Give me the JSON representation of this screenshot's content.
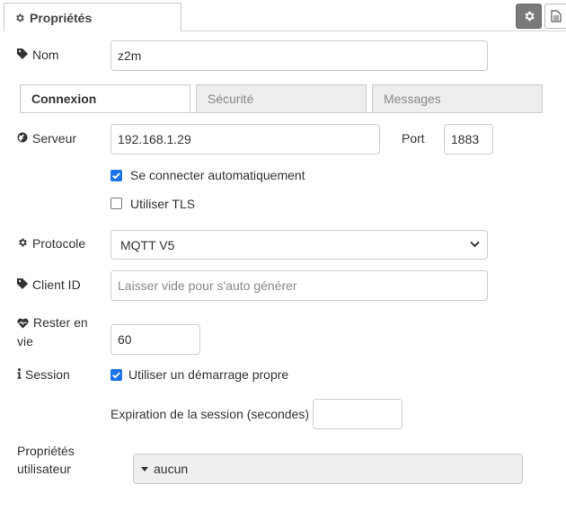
{
  "header": {
    "tab_label": "Propriétés",
    "tab_icon": "gear-icon",
    "settings_icon": "gear-icon",
    "info_icon": "document-icon"
  },
  "form": {
    "name": {
      "label": "Nom",
      "value": "z2m"
    },
    "tabs": [
      {
        "label": "Connexion",
        "active": true
      },
      {
        "label": "Sécurité",
        "active": false
      },
      {
        "label": "Messages",
        "active": false
      }
    ],
    "server": {
      "label": "Serveur",
      "value": "192.168.1.29"
    },
    "port": {
      "label": "Port",
      "value": "1883"
    },
    "auto_connect": {
      "label": "Se connecter automatiquement",
      "checked": true
    },
    "use_tls": {
      "label": "Utiliser TLS",
      "checked": false
    },
    "protocol": {
      "label": "Protocole",
      "value": "MQTT V5"
    },
    "client_id": {
      "label": "Client ID",
      "placeholder": "Laisser vide pour s'auto générer"
    },
    "keepalive": {
      "label_line1": "Rester en",
      "label_line2": "vie",
      "value": "60"
    },
    "session": {
      "label": "Session",
      "clean_start_label": "Utiliser un démarrage propre",
      "clean_start_checked": true
    },
    "session_expiry": {
      "label": "Expiration de la session (secondes)",
      "value": ""
    },
    "user_props": {
      "label_line1": "Propriétés",
      "label_line2": "utilisateur",
      "value": "aucun"
    }
  },
  "colors": {
    "checkbox_checked": "#1a73e8",
    "active_icon_button": "#7a7a7a",
    "inactive_tab": "#eeeeee"
  }
}
